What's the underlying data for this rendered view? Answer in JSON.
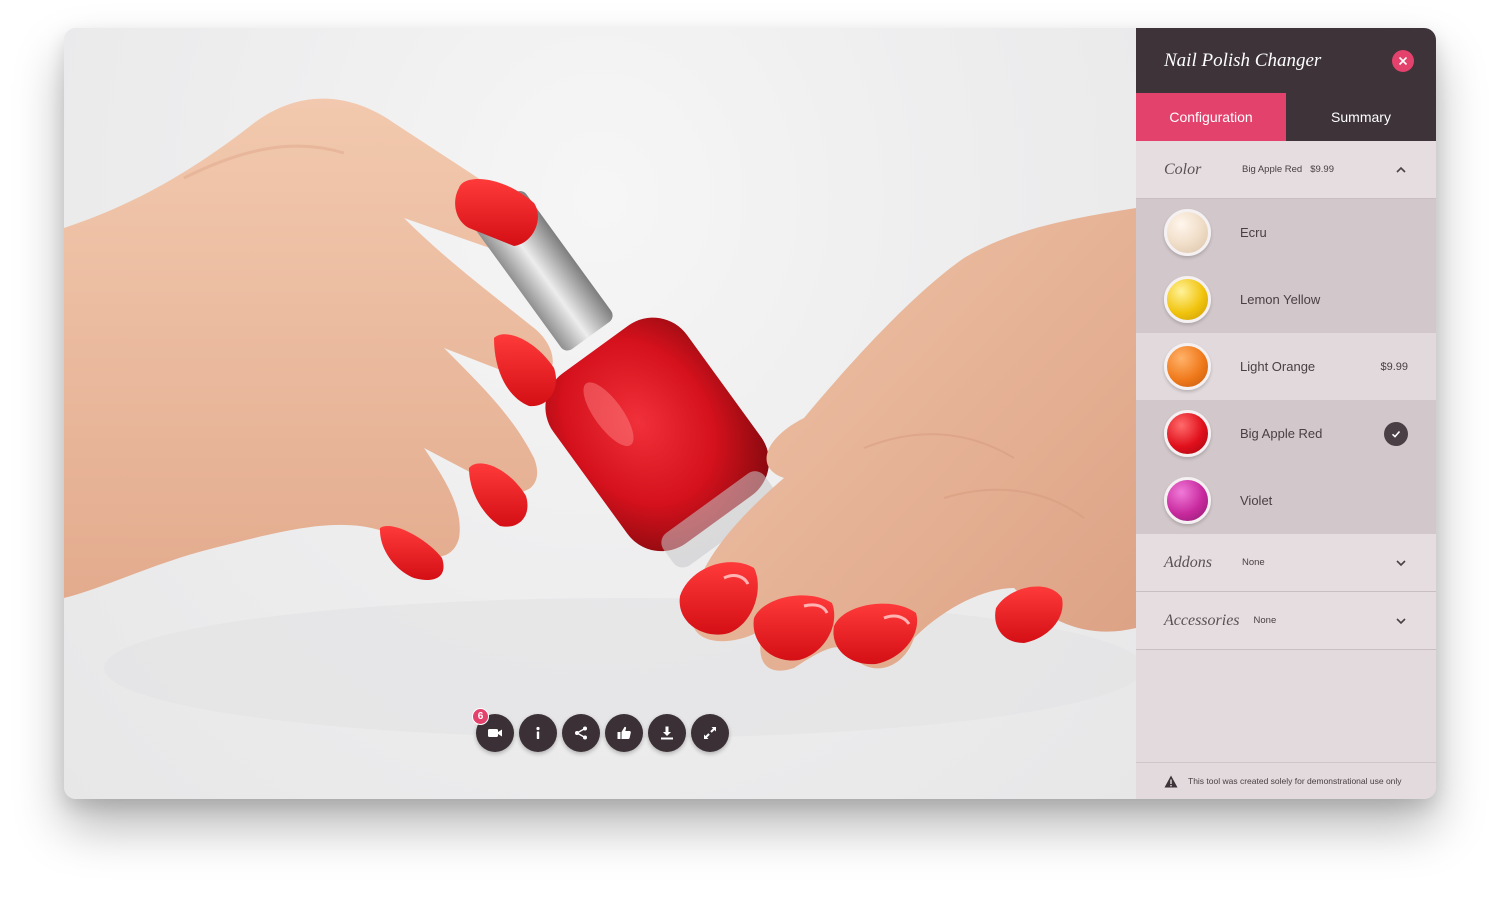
{
  "panel": {
    "title": "Nail Polish Changer",
    "tabs": [
      {
        "label": "Configuration"
      },
      {
        "label": "Summary"
      }
    ],
    "sections": {
      "color": {
        "name": "Color",
        "value": "Big Apple Red",
        "price": "$9.99"
      },
      "addons": {
        "name": "Addons",
        "value": "None"
      },
      "accessories": {
        "name": "Accessories",
        "value": "None"
      }
    },
    "swatches": [
      {
        "name": "Ecru",
        "color": "#efdcc6"
      },
      {
        "name": "Lemon Yellow",
        "color": "#f1c40f"
      },
      {
        "name": "Light Orange",
        "color": "#f07a1c",
        "price": "$9.99"
      },
      {
        "name": "Big Apple Red",
        "color": "#e0101c",
        "selected": true
      },
      {
        "name": "Violet",
        "color": "#c82a9e"
      }
    ],
    "footer_note": "This tool was created solely for demonstrational use only"
  },
  "toolbar": {
    "badge_count": "6",
    "buttons": [
      "video-icon",
      "info-icon",
      "share-icon",
      "thumbs-up-icon",
      "download-icon",
      "expand-icon"
    ]
  },
  "colors": {
    "accent": "#e2426c",
    "dark": "#3d3338",
    "polish": "#e8141e"
  }
}
